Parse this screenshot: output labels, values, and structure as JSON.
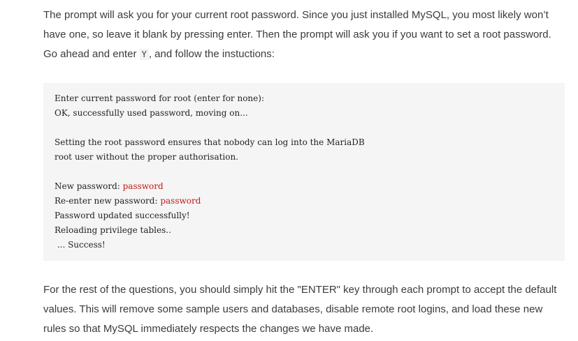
{
  "intro": {
    "text_before_code": "The prompt will ask you for your current root password. Since you just installed MySQL, you most likely won’t have one, so leave it blank by pressing enter. Then the prompt will ask you if you want to set a root password. Go ahead and enter ",
    "inline_code": "Y",
    "text_after_code": ", and follow the instuctions:"
  },
  "code": {
    "line1": "Enter current password for root (enter for none):",
    "line2": "OK, successfully used password, moving on...",
    "line3": "",
    "line4": "Setting the root password ensures that nobody can log into the MariaDB",
    "line5": "root user without the proper authorisation.",
    "line6": "",
    "line7_prefix": "New password: ",
    "line7_value": "password",
    "line8_prefix": "Re-enter new password: ",
    "line8_value": "password",
    "line9": "Password updated successfully!",
    "line10": "Reloading privilege tables..",
    "line11": " ... Success!"
  },
  "outro": {
    "text": "For the rest of the questions, you should simply hit the \"ENTER\" key through each prompt to accept the default values. This will remove some sample users and databases, disable remote root logins, and load these new rules so that MySQL immediately respects the changes we have made."
  },
  "colors": {
    "text": "#3b3b3b",
    "code_background": "#f5f5f5",
    "highlight": "#c41a16"
  }
}
